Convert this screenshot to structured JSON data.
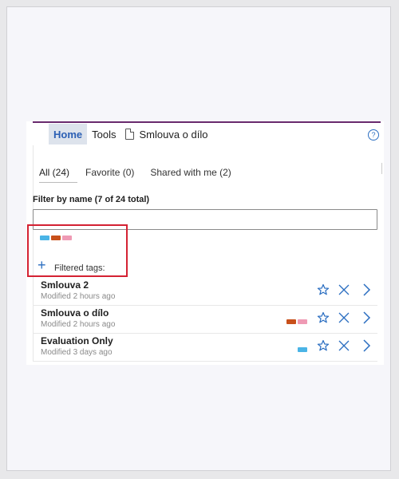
{
  "nav": {
    "home": "Home",
    "tools": "Tools",
    "document": "Smlouva o dílo",
    "help": "?"
  },
  "tabs": [
    {
      "label": "All (24)",
      "active": true
    },
    {
      "label": "Favorite (0)",
      "active": false
    },
    {
      "label": "Shared with me (2)",
      "active": false
    }
  ],
  "filter": {
    "label": "Filter by name (7 of 24 total)",
    "value": "",
    "placeholder": ""
  },
  "tag_colors": [
    "#4ab4e6",
    "#c8501a",
    "#ef9ab4"
  ],
  "filtered_tags_label": "Filtered tags:",
  "documents": [
    {
      "title": "Smlouva 2",
      "modified": "Modified 2 hours ago",
      "tags": []
    },
    {
      "title": "Smlouva o dílo",
      "modified": "Modified 2 hours ago",
      "tags": [
        "#c8501a",
        "#ef9ab4"
      ]
    },
    {
      "title": "Evaluation Only",
      "modified": "Modified 3 days ago",
      "tags": [
        "#4ab4e6"
      ]
    }
  ],
  "icons": {
    "help": "help-icon",
    "document": "document-icon",
    "plus": "plus-icon",
    "favorite": "star-icon",
    "remove": "close-icon",
    "open": "chevron-right-icon"
  },
  "accent_color": "#2b6ec1",
  "brand_bar_color": "#6a2a6e",
  "highlight_color": "#d42233"
}
